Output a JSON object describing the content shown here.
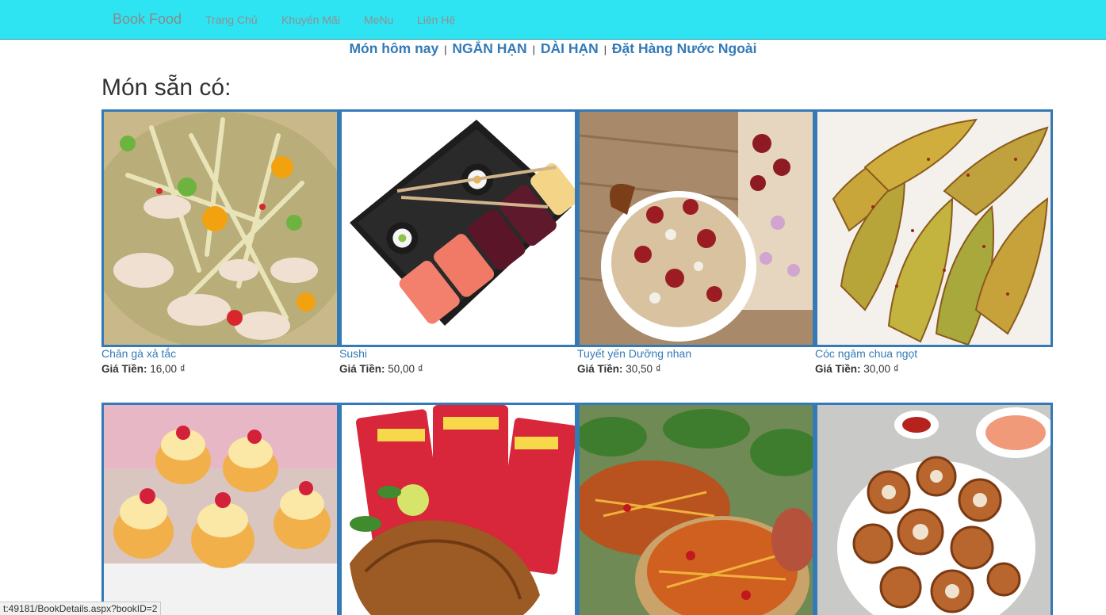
{
  "navbar": {
    "brand": "Book Food",
    "links": [
      "Trang Chủ",
      "Khuyến Mãi",
      "MeNu",
      "Liên Hệ"
    ]
  },
  "categories": {
    "links": [
      "Món hôm nay",
      "NGẮN HẠN",
      "DÀI HẠN",
      "Đặt Hàng Nước Ngoài"
    ],
    "separator": "|"
  },
  "section": {
    "title": "Món sẵn có:"
  },
  "products": [
    {
      "name": "Chân gà xả tắc",
      "price_label": "Giá Tiền:",
      "price": "16,00 ₫"
    },
    {
      "name": "Sushi",
      "price_label": "Giá Tiền:",
      "price": "50,00 ₫"
    },
    {
      "name": "Tuyết yến Dưỡng nhan",
      "price_label": "Giá Tiền:",
      "price": "30,50 ₫"
    },
    {
      "name": "Cóc ngâm chua ngọt",
      "price_label": "Giá Tiền:",
      "price": "30,00 ₫"
    },
    {
      "name": "",
      "price_label": "",
      "price": ""
    },
    {
      "name": "",
      "price_label": "",
      "price": ""
    },
    {
      "name": "",
      "price_label": "",
      "price": ""
    },
    {
      "name": "",
      "price_label": "",
      "price": ""
    }
  ],
  "status_bar": {
    "url": "t:49181/BookDetails.aspx?bookID=2"
  },
  "colors": {
    "navbar": "#2ee4f3",
    "link": "#337ab7",
    "border": "#337ab7"
  }
}
